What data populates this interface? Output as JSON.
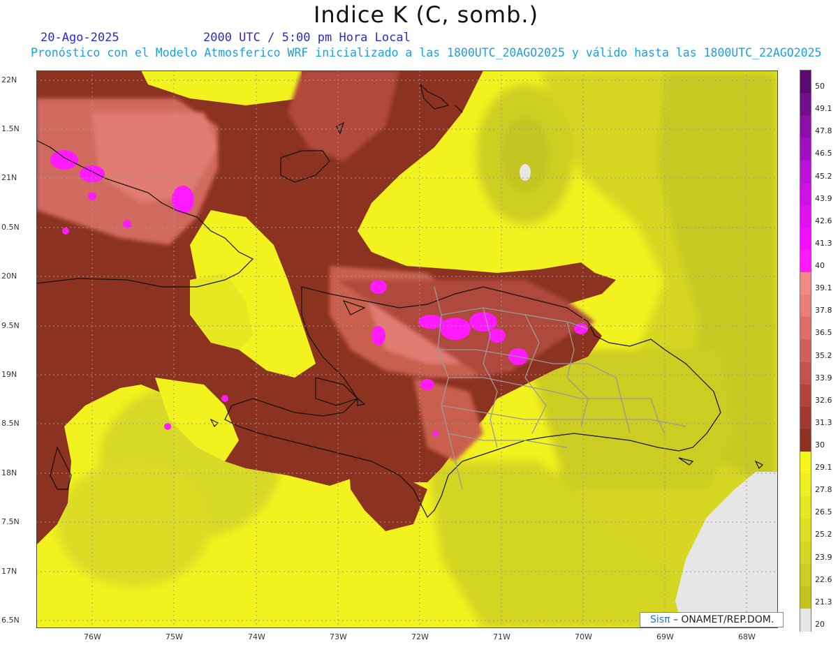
{
  "title": "Indice K (C, somb.)",
  "date": "20-Ago-2025",
  "utc_time": "2000 UTC / 5:00 pm Hora Local",
  "forecast": "Pronóstico con el Modelo Atmosferico WRF inicializado a las 1800UTC_20AGO2025 y válido hasta las  1800UTC_22AGO2025",
  "y_axis": [
    "22N",
    "1.5N",
    "21N",
    "0.5N",
    "20N",
    "9.5N",
    "19N",
    "8.5N",
    "18N",
    "7.5N",
    "17N",
    "6.5N"
  ],
  "x_axis": [
    "76W",
    "75W",
    "74W",
    "73W",
    "72W",
    "71W",
    "70W",
    "69W",
    "68W"
  ],
  "colorbar": {
    "labels": [
      "50",
      "49.1",
      "47.8",
      "46.5",
      "45.2",
      "43.9",
      "42.6",
      "41.3",
      "40",
      "39.1",
      "37.8",
      "36.5",
      "35.2",
      "33.9",
      "32.6",
      "31.3",
      "30",
      "29.1",
      "27.8",
      "26.5",
      "25.2",
      "23.9",
      "22.6",
      "21.3",
      "20"
    ],
    "colors": [
      "#5a0a6e",
      "#720f8a",
      "#8a10a8",
      "#a010c0",
      "#b812d6",
      "#cc10e6",
      "#e010f2",
      "#f010ff",
      "#ff1aff",
      "#f08a86",
      "#e87f77",
      "#dc7068",
      "#ce625a",
      "#c0544a",
      "#b0463c",
      "#a03a30",
      "#8c3220",
      "#f6f61c",
      "#eeee20",
      "#e6e622",
      "#dede24",
      "#d6d624",
      "#cccc24",
      "#c2c220",
      "#e6e6e6"
    ]
  },
  "credit": {
    "brand": "Sisπ",
    "text": " – ONAMET/REP.DOM."
  }
}
